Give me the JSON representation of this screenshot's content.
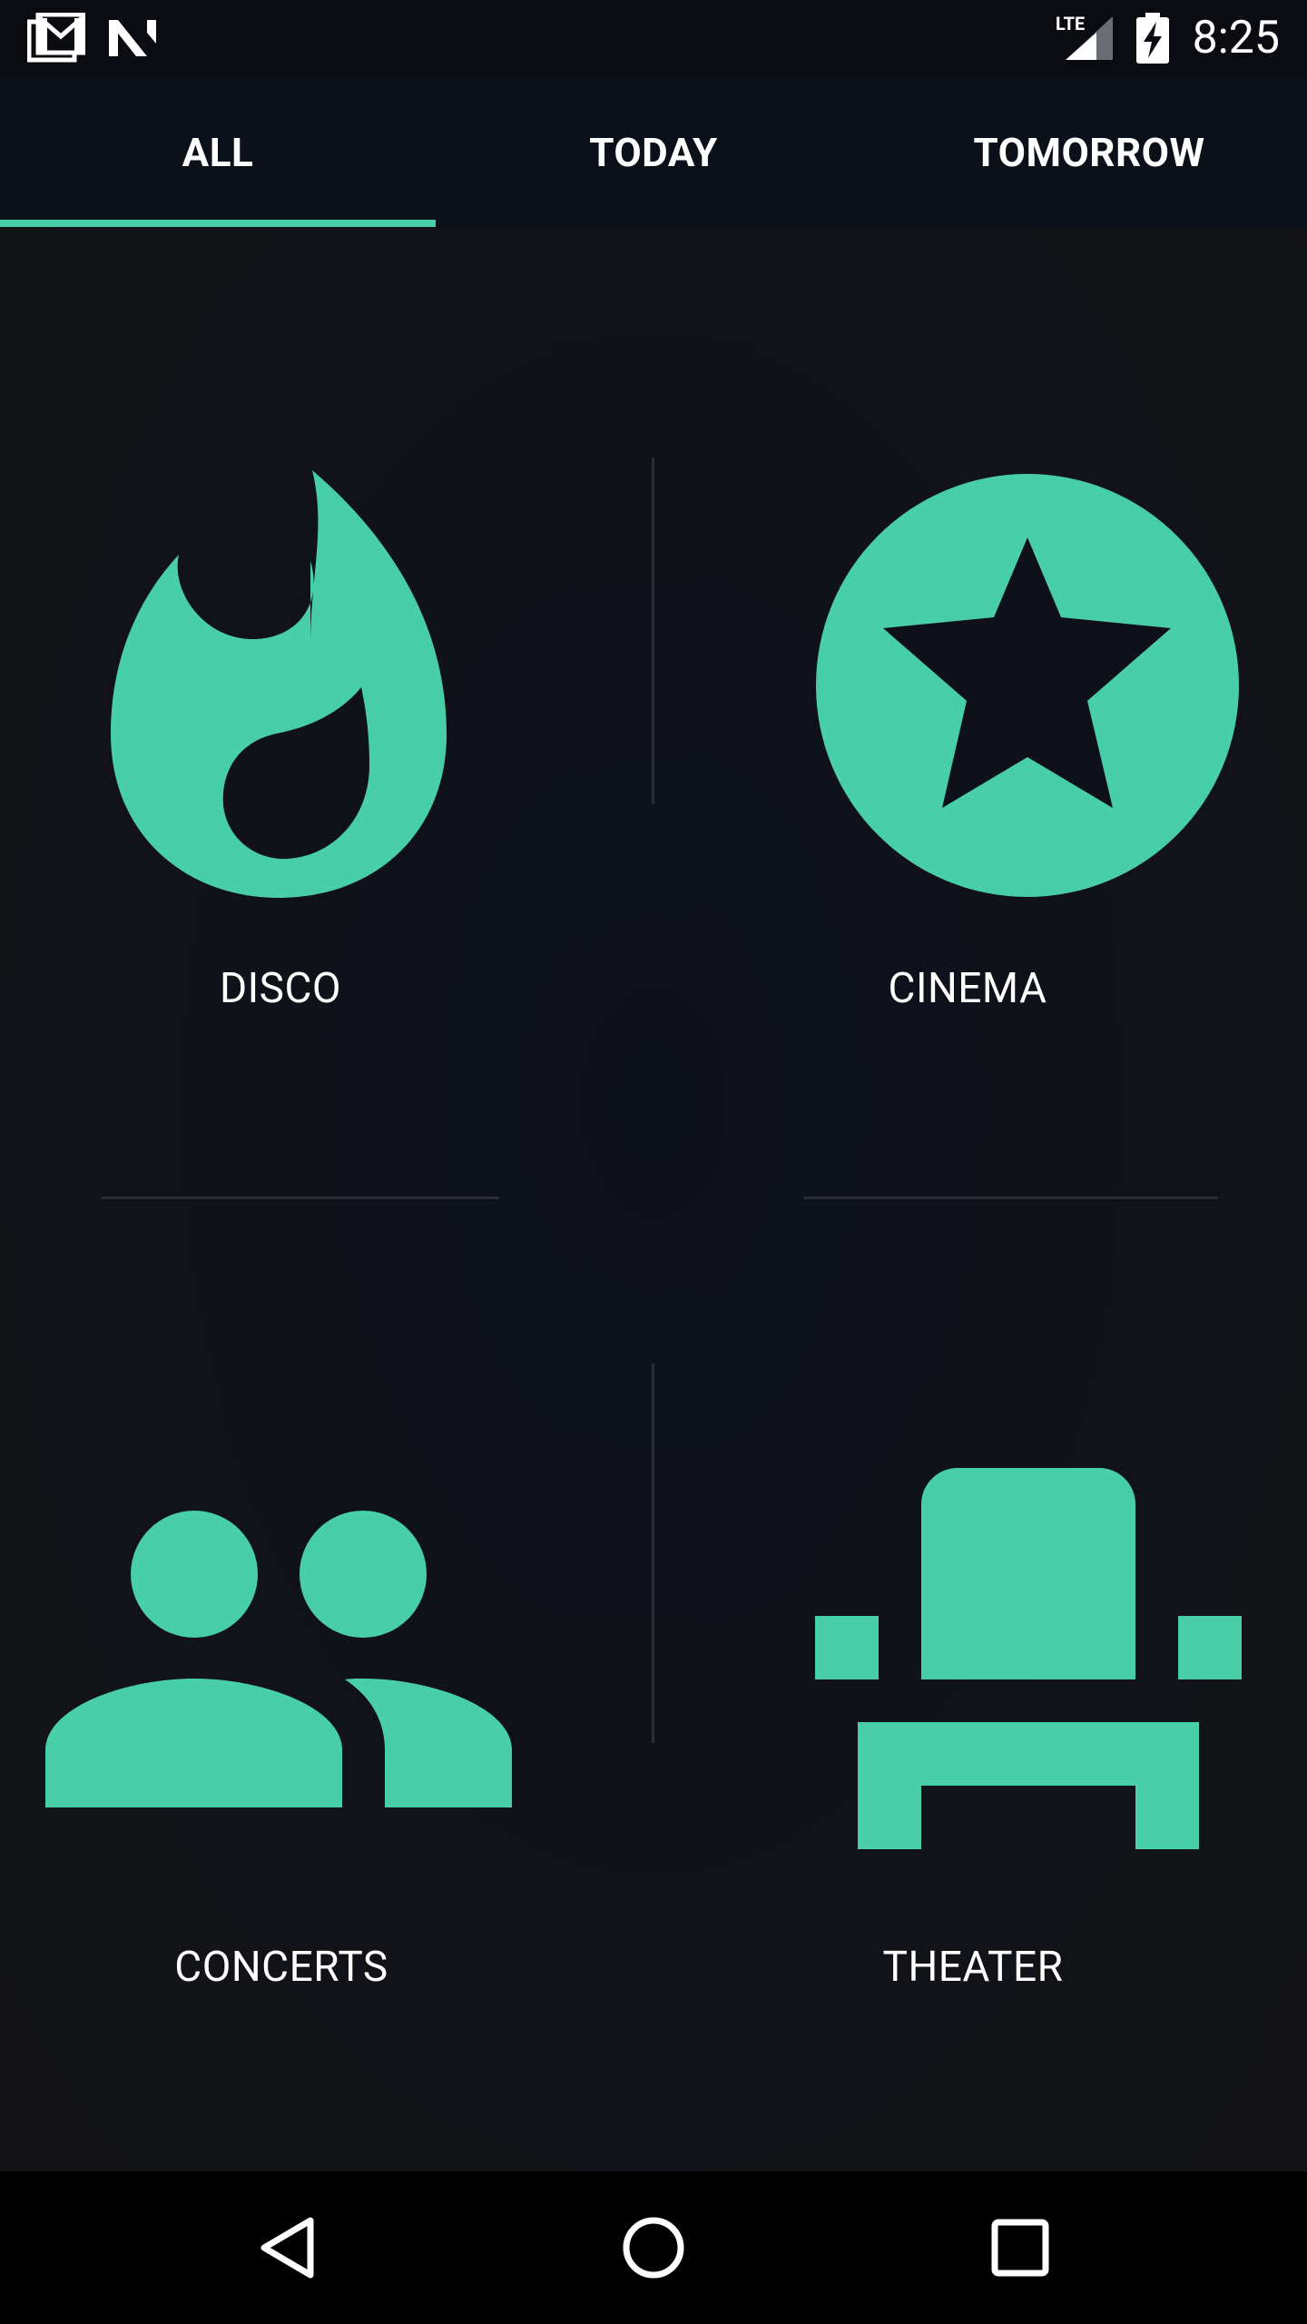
{
  "status_bar": {
    "time": "8:25",
    "network": "LTE",
    "icons": [
      "gmail-icon",
      "n-icon",
      "signal-icon",
      "battery-charging-icon"
    ]
  },
  "tabs": [
    {
      "label": "ALL",
      "selected": true
    },
    {
      "label": "TODAY",
      "selected": false
    },
    {
      "label": "TOMORROW",
      "selected": false
    }
  ],
  "categories": [
    {
      "label": "DISCO",
      "icon": "flame-icon"
    },
    {
      "label": "CINEMA",
      "icon": "star-circle-icon"
    },
    {
      "label": "CONCERTS",
      "icon": "people-icon"
    },
    {
      "label": "THEATER",
      "icon": "armchair-icon"
    }
  ],
  "navigation": [
    "back-icon",
    "home-icon",
    "recents-icon"
  ],
  "colors": {
    "accent": "#49cfa8",
    "background": "#0e1119",
    "text": "#ffffff"
  }
}
